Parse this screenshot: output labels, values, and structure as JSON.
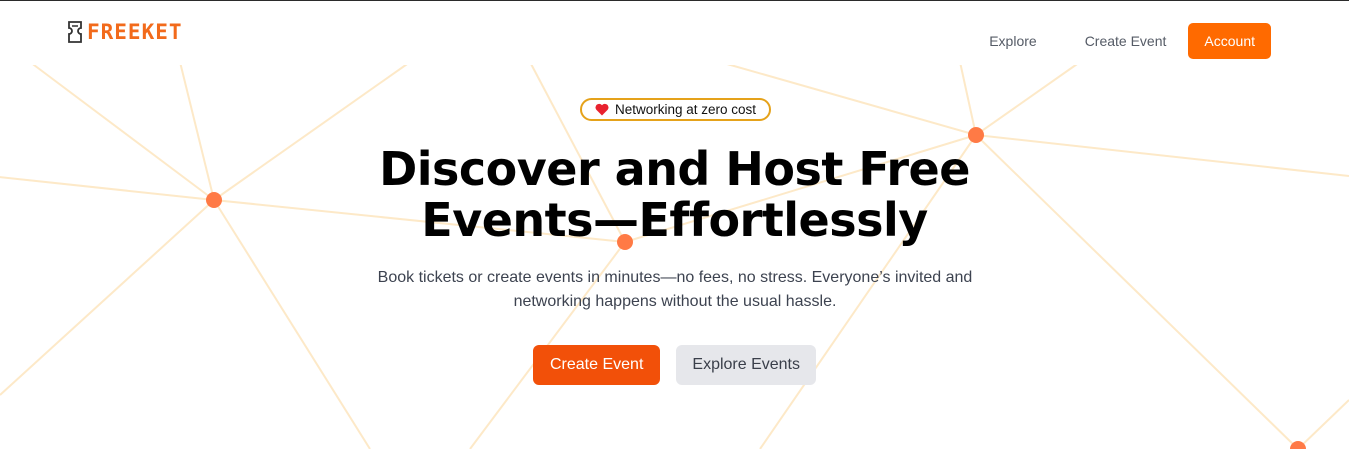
{
  "brand": {
    "name": "FREEKET",
    "logo_icon": "ticket-icon"
  },
  "nav": {
    "explore": "Explore",
    "create_event": "Create Event",
    "account": "Account"
  },
  "hero": {
    "badge_icon": "heart-icon",
    "badge_text": "Networking at zero cost",
    "title_line1": "Discover and Host Free",
    "title_line2": "Events—Effortlessly",
    "subtitle_line1": "Book tickets or create events in minutes—no fees, no stress. Everyone’s invited and",
    "subtitle_line2": "networking happens without the usual hassle.",
    "primary_cta": "Create Event",
    "secondary_cta": "Explore Events"
  },
  "colors": {
    "brand_orange": "#f26a1b",
    "account_button": "#ff6a00",
    "primary_cta": "#f25009",
    "secondary_cta": "#e6e7eb",
    "badge_border": "#e5a21a",
    "network_node": "#ff7a45",
    "network_line": "#fde8c4"
  }
}
